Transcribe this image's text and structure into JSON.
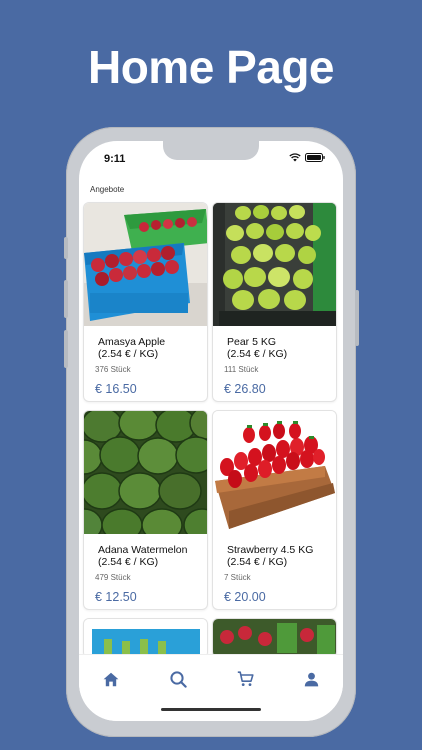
{
  "headline": "Home Page",
  "status_bar": {
    "time": "9:11",
    "icons": [
      "wifi-icon",
      "battery-icon"
    ]
  },
  "section_label": "Angebote",
  "products": [
    {
      "name": "Amasya Apple",
      "unit_price": "(2.54 € / KG)",
      "stock": "376 Stück",
      "price": "€ 16.50",
      "image": "apples-crate"
    },
    {
      "name": "Pear 5 KG",
      "unit_price": "(2.54 € / KG)",
      "stock": "111 Stück",
      "price": "€ 26.80",
      "image": "pears-crate"
    },
    {
      "name": "Adana Watermelon",
      "unit_price": "(2.54 € / KG)",
      "stock": "479 Stück",
      "price": "€ 12.50",
      "image": "watermelons"
    },
    {
      "name": "Strawberry 4.5 KG",
      "unit_price": "(2.54 € / KG)",
      "stock": "7 Stück",
      "price": "€ 20.00",
      "image": "strawberries-crate"
    }
  ],
  "tabbar": {
    "items": [
      "home-icon",
      "search-icon",
      "cart-icon",
      "profile-icon"
    ],
    "active": "home-icon"
  },
  "colors": {
    "background": "#4a6aa3",
    "accent": "#4a6aa3",
    "price": "#4a6aa3"
  }
}
